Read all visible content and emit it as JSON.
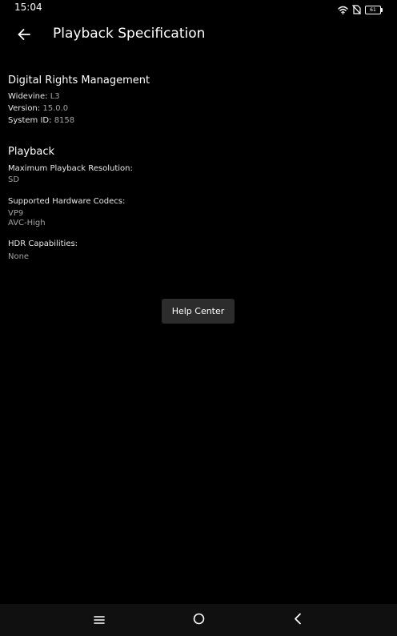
{
  "status_bar": {
    "time": "15:04",
    "battery_level": "61",
    "icons": [
      "wifi-icon",
      "no-sim-icon",
      "battery-icon"
    ]
  },
  "app_bar": {
    "title": "Playback Specification",
    "back_icon": "arrow-left-icon"
  },
  "drm": {
    "heading": "Digital Rights Management",
    "widevine_label": "Widevine:",
    "widevine_value": "L3",
    "version_label": "Version:",
    "version_value": "15.0.0",
    "system_id_label": "System ID:",
    "system_id_value": "8158"
  },
  "playback": {
    "heading": "Playback",
    "max_resolution_label": "Maximum Playback Resolution:",
    "max_resolution_value": "SD",
    "codecs_label": "Supported Hardware Codecs:",
    "codecs": [
      "VP9",
      "AVC-High"
    ],
    "hdr_label": "HDR Capabilities:",
    "hdr_value": "None"
  },
  "help_center": {
    "label": "Help Center"
  },
  "nav_bar": {
    "icons": [
      "menu-icon",
      "home-icon",
      "back-icon"
    ]
  },
  "colors": {
    "background": "#000000",
    "text_primary": "#ffffff",
    "text_secondary": "#a3a3a3",
    "button_bg": "#2c2c2c",
    "nav_bar_bg": "#101010"
  }
}
